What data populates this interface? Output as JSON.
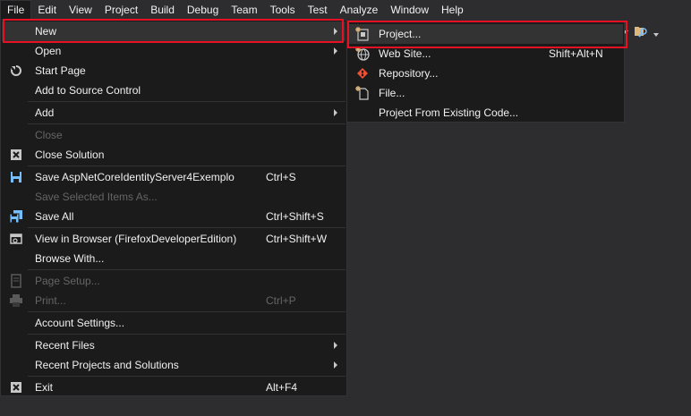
{
  "menubar": {
    "items": [
      "File",
      "Edit",
      "View",
      "Project",
      "Build",
      "Debug",
      "Team",
      "Tools",
      "Test",
      "Analyze",
      "Window",
      "Help"
    ]
  },
  "file_menu": {
    "new": "New",
    "open": "Open",
    "start_page": "Start Page",
    "add_to_source_control": "Add to Source Control",
    "add": "Add",
    "close": "Close",
    "close_solution": "Close Solution",
    "save_project": "Save AspNetCoreIdentityServer4Exemplo",
    "save_project_shortcut": "Ctrl+S",
    "save_selected_items": "Save Selected Items As...",
    "save_all": "Save All",
    "save_all_shortcut": "Ctrl+Shift+S",
    "view_in_browser": "View in Browser (FirefoxDeveloperEdition)",
    "view_in_browser_shortcut": "Ctrl+Shift+W",
    "browse_with": "Browse With...",
    "page_setup": "Page Setup...",
    "print": "Print...",
    "print_shortcut": "Ctrl+P",
    "account_settings": "Account Settings...",
    "recent_files": "Recent Files",
    "recent_projects": "Recent Projects and Solutions",
    "exit": "Exit",
    "exit_shortcut": "Alt+F4"
  },
  "new_submenu": {
    "project": "Project...",
    "web_site": "Web Site...",
    "web_site_shortcut": "Shift+Alt+N",
    "repository": "Repository...",
    "file": "File...",
    "project_from_existing_code": "Project From Existing Code..."
  },
  "colors": {
    "highlight_box": "#e81123",
    "menu_bg": "#1b1b1c",
    "app_bg": "#2d2d30"
  }
}
